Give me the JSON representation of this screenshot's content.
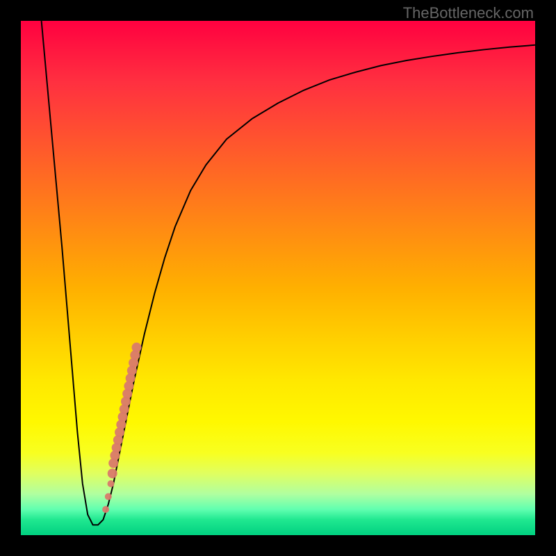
{
  "watermark": "TheBottleneck.com",
  "chart_data": {
    "type": "line",
    "title": "",
    "xlabel": "",
    "ylabel": "",
    "xlim": [
      0,
      100
    ],
    "ylim": [
      0,
      100
    ],
    "curve": {
      "x": [
        4,
        6,
        8,
        9,
        10,
        11,
        12,
        13,
        14,
        15,
        16,
        17,
        18,
        19,
        20,
        22,
        24,
        26,
        28,
        30,
        33,
        36,
        40,
        45,
        50,
        55,
        60,
        65,
        70,
        75,
        80,
        85,
        90,
        95,
        100
      ],
      "y": [
        100,
        78,
        56,
        44,
        32,
        20,
        10,
        4,
        2,
        2,
        3,
        6,
        10,
        15,
        20,
        30,
        39,
        47,
        54,
        60,
        67,
        72,
        77,
        81,
        84,
        86.5,
        88.5,
        90,
        91.3,
        92.3,
        93.1,
        93.8,
        94.4,
        94.9,
        95.3
      ]
    },
    "data_points": {
      "x": [
        16.5,
        17.0,
        17.5,
        17.8,
        18.0,
        18.3,
        18.6,
        18.9,
        19.2,
        19.5,
        19.8,
        20.1,
        20.4,
        20.7,
        21.0,
        21.3,
        21.6,
        21.9,
        22.2,
        22.5
      ],
      "y": [
        5,
        7.5,
        10,
        12,
        14,
        15.5,
        17,
        18.5,
        20,
        21.5,
        23,
        24.5,
        26,
        27.5,
        29,
        30.5,
        32,
        33.5,
        35,
        36.5
      ],
      "color": "#d97a6c"
    },
    "background_gradient": {
      "type": "vertical",
      "stops": [
        {
          "pos": 0,
          "color": "#ff0040"
        },
        {
          "pos": 50,
          "color": "#ffc000"
        },
        {
          "pos": 80,
          "color": "#ffff00"
        },
        {
          "pos": 100,
          "color": "#00d080"
        }
      ]
    }
  }
}
